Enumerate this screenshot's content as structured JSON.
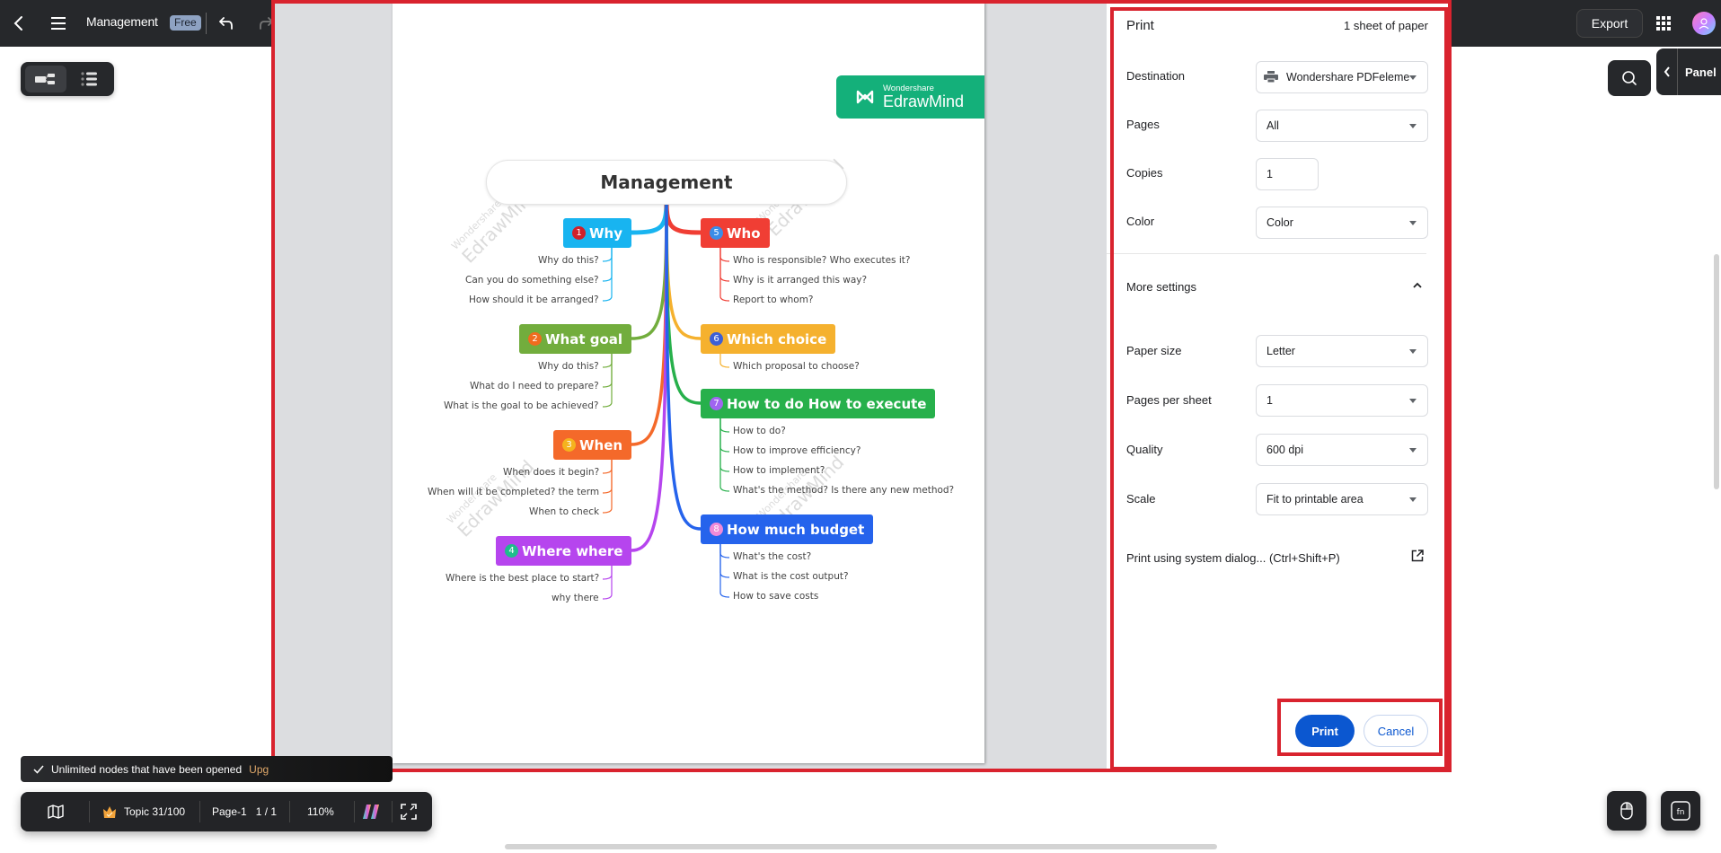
{
  "topbar": {
    "back_icon": "chevron-left-icon",
    "menu_icon": "hamburger-icon",
    "doc_title": "Management",
    "plan_badge": "Free",
    "undo_icon": "undo-icon",
    "redo_icon": "redo-icon",
    "export_label": "Export",
    "apps_icon": "apps-grid-icon",
    "avatar_icon": "user-avatar-icon"
  },
  "view_switch": {
    "items": [
      {
        "name": "mindmap-view",
        "icon": "mindmap-icon",
        "active": true
      },
      {
        "name": "outline-view",
        "icon": "outline-list-icon",
        "active": false
      }
    ]
  },
  "right_tools": {
    "search_icon": "search-icon",
    "panel_label": "Panel",
    "panel_chevron": "chevron-left-icon"
  },
  "mindmap": {
    "brand": {
      "small": "Wondershare",
      "large": "EdrawMind"
    },
    "watermark_small": "Wondershare",
    "watermark_large": "EdrawMind",
    "root": "Management",
    "branches": [
      {
        "num": "1",
        "title": "Why",
        "color": "#18b4f0",
        "num_color": "#d0202a",
        "side": "left",
        "subs": [
          "Why do this?",
          "Can you do something else?",
          "How should it be arranged?"
        ]
      },
      {
        "num": "2",
        "title": "What goal",
        "color": "#72ad3d",
        "num_color": "#f06c1e",
        "side": "left",
        "subs": [
          "Why do this?",
          "What do I need to prepare?",
          "What is the goal to be achieved?"
        ]
      },
      {
        "num": "3",
        "title": "When",
        "color": "#f4692a",
        "num_color": "#f5b31e",
        "side": "left",
        "subs": [
          "When does it begin?",
          "When will it be completed? the term",
          "When to check"
        ]
      },
      {
        "num": "4",
        "title": "Where where",
        "color": "#b645ee",
        "num_color": "#1ebc8c",
        "side": "left",
        "subs": [
          "Where is the best place to start?",
          "why there"
        ]
      },
      {
        "num": "5",
        "title": "Who",
        "color": "#f03e34",
        "num_color": "#3a8de8",
        "side": "right",
        "subs": [
          "Who is responsible? Who executes it?",
          "Why is it arranged this way?",
          "Report to whom?"
        ]
      },
      {
        "num": "6",
        "title": "Which choice",
        "color": "#f5b12e",
        "num_color": "#3d5fd6",
        "side": "right",
        "subs": [
          "Which proposal to choose?"
        ]
      },
      {
        "num": "7",
        "title": "How to do How to execute",
        "color": "#27b04b",
        "num_color": "#a065f0",
        "side": "right",
        "subs": [
          "How to do?",
          "How to improve efficiency?",
          "How to implement?",
          "What's the method? Is there any new method?"
        ]
      },
      {
        "num": "8",
        "title": "How much budget",
        "color": "#2563ec",
        "num_color": "#f08ad8",
        "side": "right",
        "subs": [
          "What's the cost?",
          "What is the cost output?",
          "How to save costs"
        ]
      }
    ]
  },
  "print_dialog": {
    "title": "Print",
    "sheet_count": "1 sheet of paper",
    "fields": {
      "destination": {
        "label": "Destination",
        "value": "Wondershare PDFeleme",
        "icon": "printer-icon"
      },
      "pages": {
        "label": "Pages",
        "value": "All"
      },
      "copies": {
        "label": "Copies",
        "value": "1"
      },
      "color": {
        "label": "Color",
        "value": "Color"
      },
      "paper_size": {
        "label": "Paper size",
        "value": "Letter"
      },
      "pages_per_sheet": {
        "label": "Pages per sheet",
        "value": "1"
      },
      "quality": {
        "label": "Quality",
        "value": "600 dpi"
      },
      "scale": {
        "label": "Scale",
        "value": "Fit to printable area"
      }
    },
    "more_settings": {
      "label": "More settings",
      "expanded": true
    },
    "system_dialog": {
      "label": "Print using system dialog... (Ctrl+Shift+P)",
      "icon": "open-external-icon"
    },
    "print_label": "Print",
    "cancel_label": "Cancel"
  },
  "toast": {
    "icon": "checkmark-icon",
    "text": "Unlimited nodes that have been opened",
    "link": "Upg"
  },
  "statusbar": {
    "map_icon": "map-icon",
    "crown_icon": "crown-icon",
    "topic_count": "Topic 31/100",
    "page_name": "Page-1",
    "page_index": "1 / 1",
    "zoom": "110%",
    "ai_icon": "edraw-ai-logo-icon",
    "fullscreen_icon": "fullscreen-icon"
  },
  "bottom_right": {
    "mouse_icon": "mouse-mode-icon",
    "fn_icon": "function-key-icon"
  }
}
